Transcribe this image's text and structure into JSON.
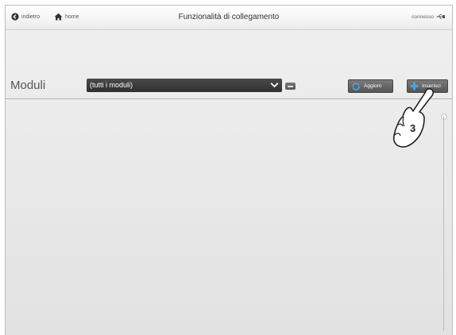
{
  "topbar": {
    "back_label": "indietro",
    "home_label": "home",
    "title": "Funzionalità di collegamento",
    "status_label": "connesso"
  },
  "toolbar": {
    "modules_label": "Moduli",
    "module_select_value": "(tutti i moduli)",
    "refresh_label": "Aggiorn",
    "insert_label": "Inserisci"
  },
  "callout": {
    "step_number": "3"
  },
  "icons": {
    "back": "back-arrow-icon",
    "home": "home-icon",
    "connection": "usb-plug-icon",
    "refresh": "refresh-icon",
    "add": "plus-icon",
    "hand": "pointing-hand-icon"
  },
  "colors": {
    "accent_blue": "#4aa3df",
    "dark_select": "#333333"
  }
}
